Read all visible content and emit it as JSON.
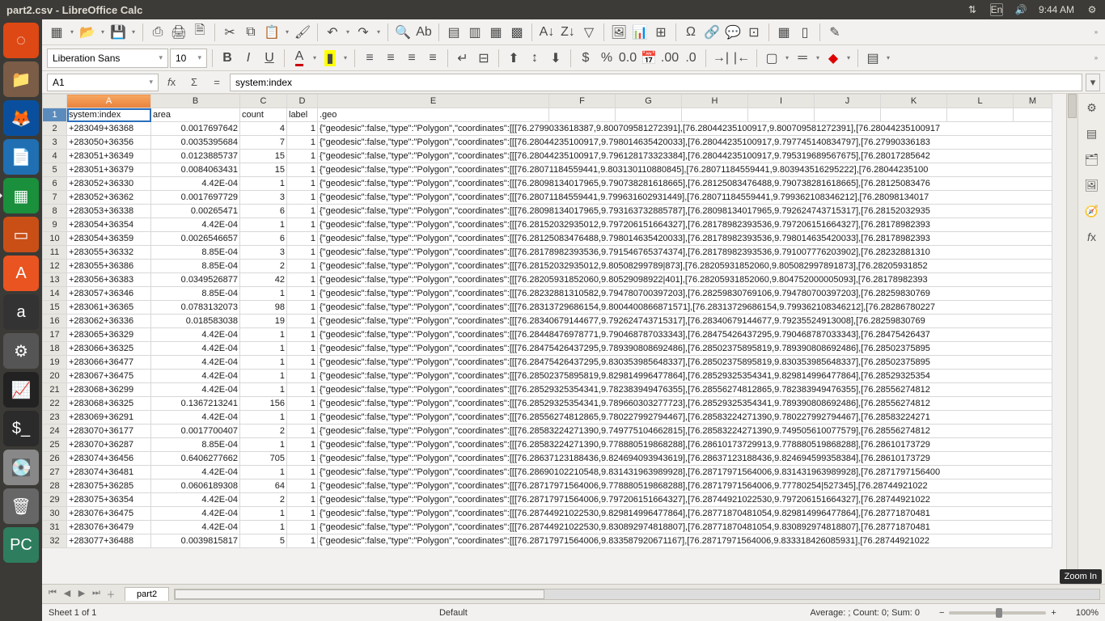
{
  "menubar": {
    "title": "part2.csv - LibreOffice Calc",
    "lang": "En",
    "time": "9:44 AM"
  },
  "toolbar2": {
    "font": "Liberation Sans",
    "size": "10"
  },
  "formula": {
    "cellref": "A1",
    "value": "system:index"
  },
  "columns": [
    "A",
    "B",
    "C",
    "D",
    "E",
    "F",
    "G",
    "H",
    "I",
    "J",
    "K",
    "L",
    "M"
  ],
  "header_row": {
    "A": "system:index",
    "B": "area",
    "C": "count",
    "D": "label",
    "E": ".geo"
  },
  "rows": [
    {
      "n": 2,
      "A": "+283049+36368",
      "B": "0.0017697642",
      "C": "4",
      "D": "1",
      "E": "{\"geodesic\":false,\"type\":\"Polygon\",\"coordinates\":[[[76.2799033618387,9.800709581272391],[76.28044235100917,9.800709581272391],[76.28044235100917"
    },
    {
      "n": 3,
      "A": "+283050+36356",
      "B": "0.0035395684",
      "C": "7",
      "D": "1",
      "E": "{\"geodesic\":false,\"type\":\"Polygon\",\"coordinates\":[[[76.28044235100917,9.798014635420033],[76.28044235100917,9.797745140834797],[76.27990336183"
    },
    {
      "n": 4,
      "A": "+283051+36349",
      "B": "0.0123885737",
      "C": "15",
      "D": "1",
      "E": "{\"geodesic\":false,\"type\":\"Polygon\",\"coordinates\":[[[76.28044235100917,9.796128173323384],[76.28044235100917,9.795319689567675],[76.28017285642"
    },
    {
      "n": 5,
      "A": "+283051+36379",
      "B": "0.0084063431",
      "C": "15",
      "D": "1",
      "E": "{\"geodesic\":false,\"type\":\"Polygon\",\"coordinates\":[[[76.28071184559441,9.803130110880845],[76.28071184559441,9.803943516295222],[76.28044235100"
    },
    {
      "n": 6,
      "A": "+283052+36330",
      "B": "4.42E-04",
      "C": "1",
      "D": "1",
      "E": "{\"geodesic\":false,\"type\":\"Polygon\",\"coordinates\":[[[76.28098134017965,9.790738281618665],[76.28125083476488,9.790738281618665],[76.28125083476"
    },
    {
      "n": 7,
      "A": "+283052+36362",
      "B": "0.0017697729",
      "C": "3",
      "D": "1",
      "E": "{\"geodesic\":false,\"type\":\"Polygon\",\"coordinates\":[[[76.28071184559441,9.799631602931449],[76.28071184559441,9.799362108346212],[76.28098134017"
    },
    {
      "n": 8,
      "A": "+283053+36338",
      "B": "0.00265471",
      "C": "6",
      "D": "1",
      "E": "{\"geodesic\":false,\"type\":\"Polygon\",\"coordinates\":[[[76.28098134017965,9.793163732885787],[76.28098134017965,9.792624743715317],[76.28152032935"
    },
    {
      "n": 9,
      "A": "+283054+36354",
      "B": "4.42E-04",
      "C": "1",
      "D": "1",
      "E": "{\"geodesic\":false,\"type\":\"Polygon\",\"coordinates\":[[[76.28152032935012,9.797206151664327],[76.28178982393536,9.797206151664327],[76.28178982393"
    },
    {
      "n": 10,
      "A": "+283054+36359",
      "B": "0.0026546657",
      "C": "6",
      "D": "1",
      "E": "{\"geodesic\":false,\"type\":\"Polygon\",\"coordinates\":[[[76.28125083476488,9.798014635420033],[76.28178982393536,9.798014635420033],[76.28178982393"
    },
    {
      "n": 11,
      "A": "+283055+36332",
      "B": "8.85E-04",
      "C": "3",
      "D": "1",
      "E": "{\"geodesic\":false,\"type\":\"Polygon\",\"coordinates\":[[[76.28178982393536,9.791546765374374],[76.28178982393536,9.791007776203902],[76.28232881310"
    },
    {
      "n": 12,
      "A": "+283055+36386",
      "B": "8.85E-04",
      "C": "2",
      "D": "1",
      "E": "{\"geodesic\":false,\"type\":\"Polygon\",\"coordinates\":[[[76.28152032935012,9.80508299789|873],[76.28205931852060,9.805082997891873],[76.28205931852"
    },
    {
      "n": 13,
      "A": "+283056+36383",
      "B": "0.0349526877",
      "C": "42",
      "D": "1",
      "E": "{\"geodesic\":false,\"type\":\"Polygon\",\"coordinates\":[[[76.28205931852060,9.80529098922|401],[76.28205931852060,9.804752000005093],[76.28178982393"
    },
    {
      "n": 14,
      "A": "+283057+36346",
      "B": "8.85E-04",
      "C": "1",
      "D": "1",
      "E": "{\"geodesic\":false,\"type\":\"Polygon\",\"coordinates\":[[[76.28232881310582,9.794780700397203],[76.28259830769106,9.794780700397203],[76.28259830769"
    },
    {
      "n": 15,
      "A": "+283061+36365",
      "B": "0.0783132073",
      "C": "98",
      "D": "1",
      "E": "{\"geodesic\":false,\"type\":\"Polygon\",\"coordinates\":[[[76.28313729686154,9.8004400866871571],[76.28313729686154,9.799362108346212],[76.28286780227"
    },
    {
      "n": 16,
      "A": "+283062+36336",
      "B": "0.018583038",
      "C": "19",
      "D": "1",
      "E": "{\"geodesic\":false,\"type\":\"Polygon\",\"coordinates\":[[[76.28340679144677,9.792624743715317],[76.28340679144677,9.79235524913008],[76.28259830769"
    },
    {
      "n": 17,
      "A": "+283065+36329",
      "B": "4.42E-04",
      "C": "1",
      "D": "1",
      "E": "{\"geodesic\":false,\"type\":\"Polygon\",\"coordinates\":[[[76.28448476978771,9.790468787033343],[76.28475426437295,9.790468787033343],[76.28475426437"
    },
    {
      "n": 18,
      "A": "+283066+36325",
      "B": "4.42E-04",
      "C": "1",
      "D": "1",
      "E": "{\"geodesic\":false,\"type\":\"Polygon\",\"coordinates\":[[[76.28475426437295,9.789390808692486],[76.28502375895819,9.789390808692486],[76.28502375895"
    },
    {
      "n": 19,
      "A": "+283066+36477",
      "B": "4.42E-04",
      "C": "1",
      "D": "1",
      "E": "{\"geodesic\":false,\"type\":\"Polygon\",\"coordinates\":[[[76.28475426437295,9.830353985648337],[76.28502375895819,9.830353985648337],[76.28502375895"
    },
    {
      "n": 20,
      "A": "+283067+36475",
      "B": "4.42E-04",
      "C": "1",
      "D": "1",
      "E": "{\"geodesic\":false,\"type\":\"Polygon\",\"coordinates\":[[[76.28502375895819,9.829814996477864],[76.28529325354341,9.829814996477864],[76.28529325354"
    },
    {
      "n": 21,
      "A": "+283068+36299",
      "B": "4.42E-04",
      "C": "1",
      "D": "1",
      "E": "{\"geodesic\":false,\"type\":\"Polygon\",\"coordinates\":[[[76.28529325354341,9.782383949476355],[76.28556274812865,9.782383949476355],[76.28556274812"
    },
    {
      "n": 22,
      "A": "+283068+36325",
      "B": "0.1367213241",
      "C": "156",
      "D": "1",
      "E": "{\"geodesic\":false,\"type\":\"Polygon\",\"coordinates\":[[[76.28529325354341,9.789660303277723],[76.28529325354341,9.789390808692486],[76.28556274812"
    },
    {
      "n": 23,
      "A": "+283069+36291",
      "B": "4.42E-04",
      "C": "1",
      "D": "1",
      "E": "{\"geodesic\":false,\"type\":\"Polygon\",\"coordinates\":[[[76.28556274812865,9.780227992794467],[76.28583224271390,9.780227992794467],[76.28583224271"
    },
    {
      "n": 24,
      "A": "+283070+36177",
      "B": "0.0017700407",
      "C": "2",
      "D": "1",
      "E": "{\"geodesic\":false,\"type\":\"Polygon\",\"coordinates\":[[[76.28583224271390,9.749775104662815],[76.28583224271390,9.749505610077579],[76.28556274812"
    },
    {
      "n": 25,
      "A": "+283070+36287",
      "B": "8.85E-04",
      "C": "1",
      "D": "1",
      "E": "{\"geodesic\":false,\"type\":\"Polygon\",\"coordinates\":[[[76.28583224271390,9.778880519868288],[76.28610173729913,9.778880519868288],[76.28610173729"
    },
    {
      "n": 26,
      "A": "+283074+36456",
      "B": "0.6406277662",
      "C": "705",
      "D": "1",
      "E": "{\"geodesic\":false,\"type\":\"Polygon\",\"coordinates\":[[[76.28637123188436,9.824694093943619],[76.28637123188436,9.824694599358384],[76.28610173729"
    },
    {
      "n": 27,
      "A": "+283074+36481",
      "B": "4.42E-04",
      "C": "1",
      "D": "1",
      "E": "{\"geodesic\":false,\"type\":\"Polygon\",\"coordinates\":[[[76.28690102210548,9.831431963989928],[76.28717971564006,9.831431963989928],[76.2871797156400"
    },
    {
      "n": 28,
      "A": "+283075+36285",
      "B": "0.0606189308",
      "C": "64",
      "D": "1",
      "E": "{\"geodesic\":false,\"type\":\"Polygon\",\"coordinates\":[[[76.28717971564006,9.778880519868288],[76.28717971564006,9.77780254|527345],[76.28744921022"
    },
    {
      "n": 29,
      "A": "+283075+36354",
      "B": "4.42E-04",
      "C": "2",
      "D": "1",
      "E": "{\"geodesic\":false,\"type\":\"Polygon\",\"coordinates\":[[[76.28717971564006,9.797206151664327],[76.28744921022530,9.797206151664327],[76.28744921022"
    },
    {
      "n": 30,
      "A": "+283076+36475",
      "B": "4.42E-04",
      "C": "1",
      "D": "1",
      "E": "{\"geodesic\":false,\"type\":\"Polygon\",\"coordinates\":[[[76.28744921022530,9.829814996477864],[76.28771870481054,9.829814996477864],[76.28771870481"
    },
    {
      "n": 31,
      "A": "+283076+36479",
      "B": "4.42E-04",
      "C": "1",
      "D": "1",
      "E": "{\"geodesic\":false,\"type\":\"Polygon\",\"coordinates\":[[[76.28744921022530,9.830892974818807],[76.28771870481054,9.830892974818807],[76.28771870481"
    },
    {
      "n": 32,
      "A": "+283077+36488",
      "B": "0.0039815817",
      "C": "5",
      "D": "1",
      "E": "{\"geodesic\":false,\"type\":\"Polygon\",\"coordinates\":[[[76.28717971564006,9.833587920671167],[76.28717971564006,9.833318426085931],[76.28744921022"
    }
  ],
  "tabs": {
    "sheet": "part2"
  },
  "status": {
    "sheet_info": "Sheet 1 of 1",
    "style": "Default",
    "calc": "Average: ; Count: 0; Sum: 0",
    "zoom": "100%"
  },
  "tooltip": "Zoom In",
  "sidebar_icons": [
    "≡",
    "☰",
    "▦",
    "⊞",
    "A",
    "fx"
  ]
}
